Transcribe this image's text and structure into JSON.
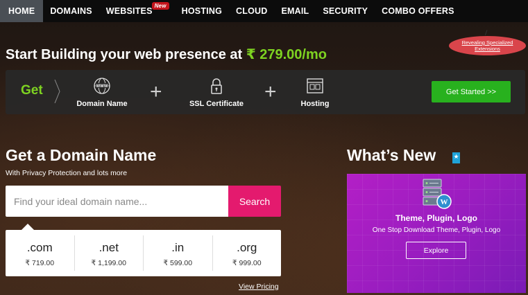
{
  "nav": {
    "items": [
      {
        "label": "HOME",
        "active": true
      },
      {
        "label": "DOMAINS"
      },
      {
        "label": "WEBSITES",
        "badge": "New"
      },
      {
        "label": "HOSTING"
      },
      {
        "label": "CLOUD"
      },
      {
        "label": "EMAIL"
      },
      {
        "label": "SECURITY"
      },
      {
        "label": "COMBO OFFERS"
      }
    ]
  },
  "ribbon": {
    "label": "Revealing Specialized Extensions"
  },
  "headline": {
    "text": "Start Building your web presence at ",
    "currency": "₹",
    "price": " 279.00/mo"
  },
  "bundle": {
    "get_label": "Get",
    "items": [
      {
        "label": "Domain Name",
        "icon": "www-globe-icon"
      },
      {
        "label": "SSL Certificate",
        "icon": "padlock-icon"
      },
      {
        "label": "Hosting",
        "icon": "hosting-window-icon"
      }
    ],
    "cta_label": "Get Started >>",
    "cta_color": "#28b11e"
  },
  "domain": {
    "title": "Get a Domain Name",
    "subtitle": "With Privacy Protection and lots more",
    "search_placeholder": "Find your ideal domain name...",
    "search_button": "Search",
    "search_color": "#e41a6e",
    "tlds": [
      {
        "ext": ".com",
        "price": "₹ 719.00"
      },
      {
        "ext": ".net",
        "price": "₹ 1,199.00"
      },
      {
        "ext": ".in",
        "price": "₹ 599.00"
      },
      {
        "ext": ".org",
        "price": "₹ 999.00"
      }
    ],
    "view_pricing": "View Pricing"
  },
  "whats_new": {
    "title": "What’s New",
    "promo_title": "Theme, Plugin, Logo",
    "promo_subtitle": "One Stop Download Theme, Plugin, Logo",
    "promo_button": "Explore"
  }
}
